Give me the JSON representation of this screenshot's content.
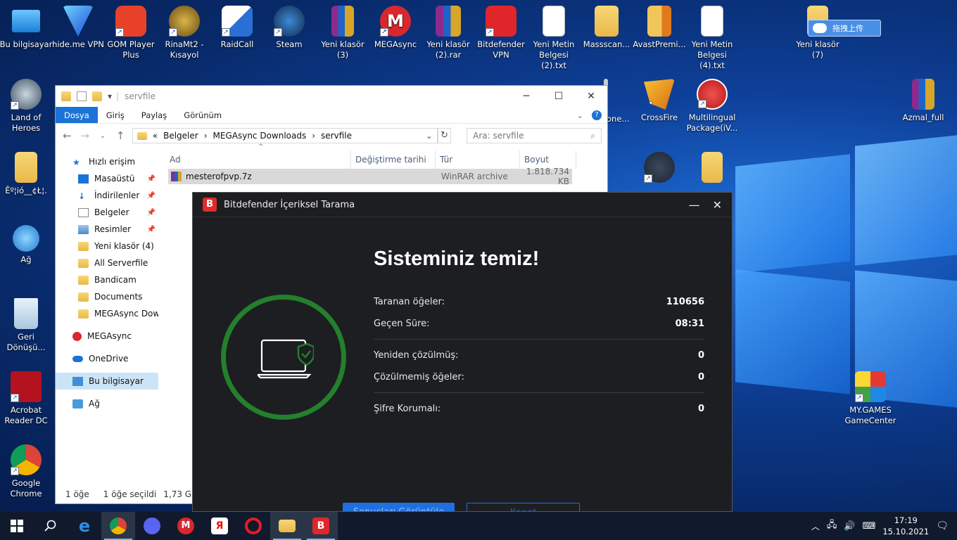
{
  "desktop": {
    "icons": [
      {
        "label": "Bu bilgisayar"
      },
      {
        "label": "hide.me VPN"
      },
      {
        "label": "GOM Player Plus"
      },
      {
        "label": "RinaMt2 - Kısayol"
      },
      {
        "label": "RaidCall"
      },
      {
        "label": "Steam"
      },
      {
        "label": "Yeni klasör (3)"
      },
      {
        "label": "MEGAsync"
      },
      {
        "label": "Yeni klasör (2).rar"
      },
      {
        "label": "Bitdefender VPN"
      },
      {
        "label": "Yeni Metin Belgesi (2).txt"
      },
      {
        "label": "Massscan..."
      },
      {
        "label": "AvastPremi..."
      },
      {
        "label": "Yeni Metin Belgesi (4).txt"
      },
      {
        "label": "Yeni klasör (7)"
      },
      {
        "label": "Land of Heroes"
      },
      {
        "label": "Êº¦ió__¢Ł¦."
      },
      {
        "label": "Ağ"
      },
      {
        "label": "Geri Dönüşü..."
      },
      {
        "label": "Acrobat Reader DC"
      },
      {
        "label": "Google Chrome"
      },
      {
        "label": "CrossFire"
      },
      {
        "label": "Multilingual Package(iV..."
      },
      {
        "label": "Azmal_full"
      },
      {
        "label": "MY.GAMES GameCenter"
      },
      {
        "label": "one..."
      }
    ],
    "upload_badge": "拖拽上传"
  },
  "explorer": {
    "title": "servfile",
    "ribbon": [
      "Dosya",
      "Giriş",
      "Paylaş",
      "Görünüm"
    ],
    "path": [
      "«",
      "Belgeler",
      "›",
      "MEGAsync Downloads",
      "›",
      "servfile"
    ],
    "search_placeholder": "Ara: servfile",
    "nav": [
      {
        "label": "Hızlı erişim"
      },
      {
        "label": "Masaüstü"
      },
      {
        "label": "İndirilenler"
      },
      {
        "label": "Belgeler"
      },
      {
        "label": "Resimler"
      },
      {
        "label": "Yeni klasör (4)"
      },
      {
        "label": "All Serverfile"
      },
      {
        "label": "Bandicam"
      },
      {
        "label": "Documents"
      },
      {
        "label": "MEGAsync Down"
      },
      {
        "label": "MEGAsync"
      },
      {
        "label": "OneDrive"
      },
      {
        "label": "Bu bilgisayar"
      },
      {
        "label": "Ağ"
      }
    ],
    "columns": [
      "Ad",
      "Değiştirme tarihi",
      "Tür",
      "Boyut"
    ],
    "files": [
      {
        "name": "mesterofpvp.7z",
        "date": "",
        "type": "WinRAR archive",
        "size": "1.818.734 KB"
      }
    ],
    "status": {
      "count": "1 öğe",
      "selected": "1 öğe seçildi",
      "size": "1,73 GB"
    }
  },
  "bitdefender": {
    "title": "Bitdefender İçeriksel Tarama",
    "headline": "Sisteminiz temiz!",
    "stats": [
      {
        "label": "Taranan öğeler:",
        "value": "110656"
      },
      {
        "label": "Geçen Süre:",
        "value": "08:31"
      },
      {
        "label": "Yeniden çözülmüş:",
        "value": "0"
      },
      {
        "label": "Çözülmemiş öğeler:",
        "value": "0"
      },
      {
        "label": "Şifre Korumalı:",
        "value": "0"
      }
    ],
    "primary_button": "Sonuçları Görüntüle",
    "secondary_button": "Kapat",
    "accent": "#23802c"
  },
  "taskbar": {
    "time": "17:19",
    "date": "15.10.2021"
  }
}
